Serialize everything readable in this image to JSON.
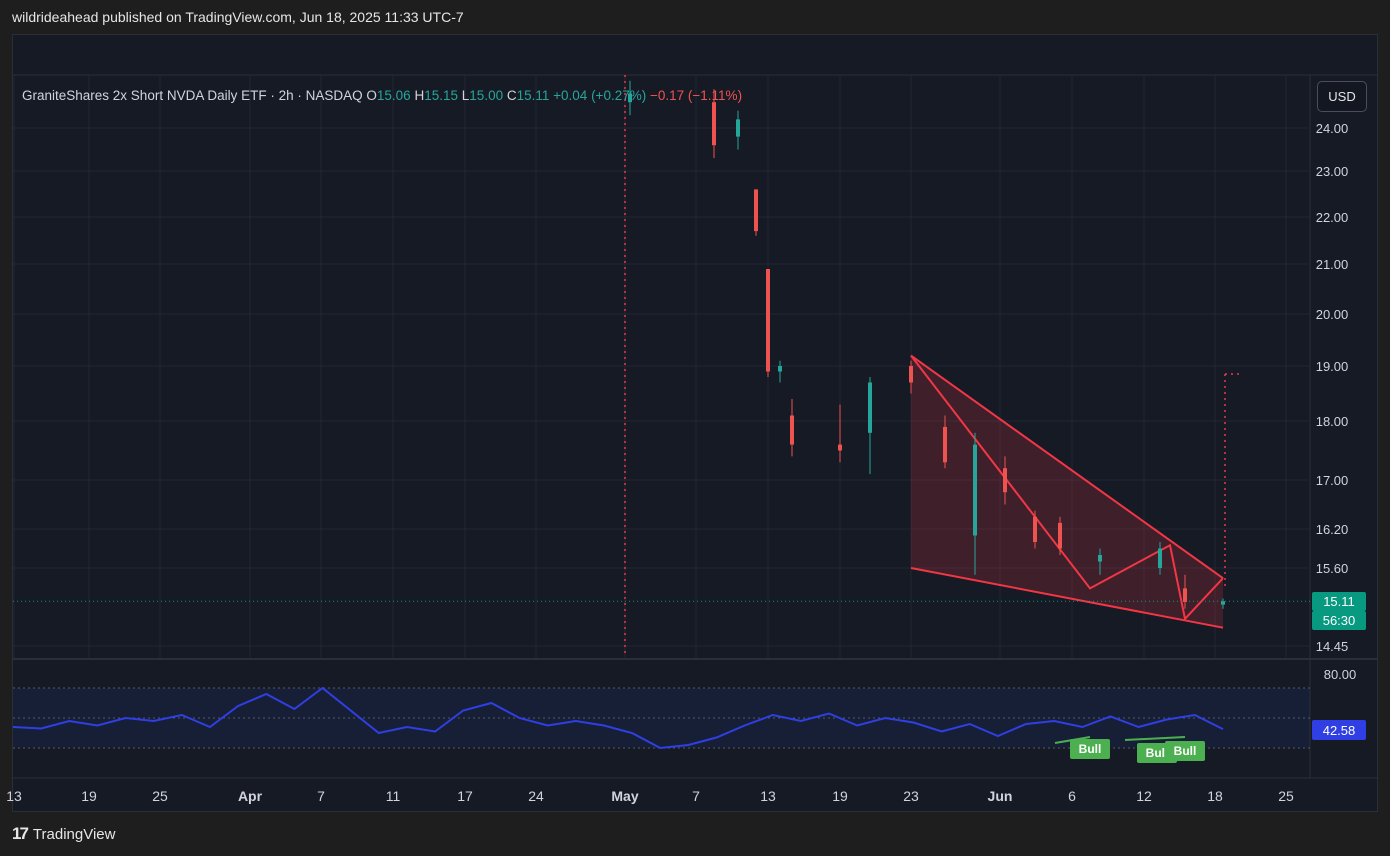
{
  "page": {
    "header": "wildrideahead published on TradingView.com, Jun 18, 2025 11:33 UTC-7",
    "brand": "TradingView"
  },
  "legend": {
    "name": "GraniteShares 2x Short NVDA Daily ETF · 2h · NASDAQ",
    "o_label": "O",
    "o_value": "15.06",
    "h_label": "H",
    "h_value": "15.15",
    "l_label": "L",
    "l_value": "15.00",
    "c_label": "C",
    "c_value": "15.11",
    "change": "+0.04 (+0.27%)",
    "alt_change": "−0.17 (−1.11%)"
  },
  "controls": {
    "currency": "USD"
  },
  "colors": {
    "up": "#26a69a",
    "down": "#ef5350",
    "rsi": "#2f3fe3",
    "pattern": "#f23645",
    "bull": "#4caf50",
    "bg": "#161a25",
    "grid": "#232733"
  },
  "chart_data": {
    "type": "candlestick",
    "instrument": "GraniteShares 2x Short NVDA Daily ETF",
    "interval": "2h",
    "exchange": "NASDAQ",
    "price_ticks": [
      "24.00",
      "23.00",
      "22.00",
      "21.00",
      "20.00",
      "19.00",
      "18.00",
      "17.00",
      "16.20",
      "15.60",
      "14.45"
    ],
    "price_tick_values": [
      24,
      23,
      22,
      21,
      20,
      19,
      18,
      17,
      16.2,
      15.6,
      14.45
    ],
    "x_ticks": [
      "13",
      "19",
      "25",
      "Apr",
      "7",
      "11",
      "17",
      "24",
      "May",
      "7",
      "13",
      "19",
      "23",
      "Jun",
      "6",
      "12",
      "18",
      "25"
    ],
    "last_price": "15.11",
    "countdown": "56:30",
    "candles_daily_approx": [
      {
        "date": "May 1",
        "o": 24.6,
        "h": 25.1,
        "l": 24.3,
        "c": 24.8
      },
      {
        "date": "May 7",
        "o": 24.6,
        "h": 24.9,
        "l": 23.3,
        "c": 23.6
      },
      {
        "date": "May 9",
        "o": 23.8,
        "h": 24.4,
        "l": 23.5,
        "c": 24.2
      },
      {
        "date": "May 12",
        "o": 22.6,
        "h": 22.6,
        "l": 21.6,
        "c": 21.7
      },
      {
        "date": "May 13",
        "o": 20.9,
        "h": 20.9,
        "l": 18.8,
        "c": 18.9
      },
      {
        "date": "May 14",
        "o": 18.9,
        "h": 19.1,
        "l": 18.7,
        "c": 19.0
      },
      {
        "date": "May 15",
        "o": 18.1,
        "h": 18.4,
        "l": 17.4,
        "c": 17.6
      },
      {
        "date": "May 19",
        "o": 17.6,
        "h": 18.3,
        "l": 17.3,
        "c": 17.5
      },
      {
        "date": "May 21",
        "o": 17.8,
        "h": 18.8,
        "l": 17.1,
        "c": 18.7
      },
      {
        "date": "May 23",
        "o": 19.0,
        "h": 19.1,
        "l": 18.5,
        "c": 18.7
      },
      {
        "date": "May 27",
        "o": 17.9,
        "h": 18.1,
        "l": 17.2,
        "c": 17.3
      },
      {
        "date": "May 29",
        "o": 16.1,
        "h": 17.8,
        "l": 15.5,
        "c": 17.6
      },
      {
        "date": "Jun 2",
        "o": 17.2,
        "h": 17.4,
        "l": 16.6,
        "c": 16.8
      },
      {
        "date": "Jun 4",
        "o": 16.4,
        "h": 16.5,
        "l": 15.9,
        "c": 16.0
      },
      {
        "date": "Jun 6",
        "o": 16.3,
        "h": 16.4,
        "l": 15.8,
        "c": 15.9
      },
      {
        "date": "Jun 10",
        "o": 15.7,
        "h": 15.9,
        "l": 15.5,
        "c": 15.8
      },
      {
        "date": "Jun 13",
        "o": 15.6,
        "h": 16.0,
        "l": 15.5,
        "c": 15.9
      },
      {
        "date": "Jun 16",
        "o": 15.3,
        "h": 15.5,
        "l": 15.0,
        "c": 15.1
      },
      {
        "date": "Jun 18",
        "o": 15.06,
        "h": 15.15,
        "l": 15.0,
        "c": 15.11
      }
    ],
    "rsi": {
      "ticks": [
        "80.00"
      ],
      "last": "42.58",
      "band": [
        30,
        70
      ],
      "approx_values": [
        44,
        43,
        48,
        45,
        50,
        48,
        52,
        44,
        58,
        66,
        56,
        70,
        55,
        40,
        44,
        41,
        55,
        60,
        50,
        45,
        48,
        45,
        40,
        30,
        32,
        37,
        45,
        52,
        48,
        53,
        45,
        50,
        47,
        41,
        46,
        38,
        46,
        48,
        44,
        51,
        44,
        49,
        52,
        42.58
      ],
      "annotations": [
        "Bull",
        "Bull",
        "Bull"
      ]
    },
    "pattern": {
      "type": "falling wedge",
      "upper_line": [
        {
          "date": "May 23",
          "price": 19.2
        },
        {
          "date": "Jun 18",
          "price": 15.45
        }
      ],
      "lower_line": [
        {
          "date": "May 23",
          "price": 15.6
        },
        {
          "date": "Jun 18",
          "price": 14.72
        }
      ]
    }
  }
}
